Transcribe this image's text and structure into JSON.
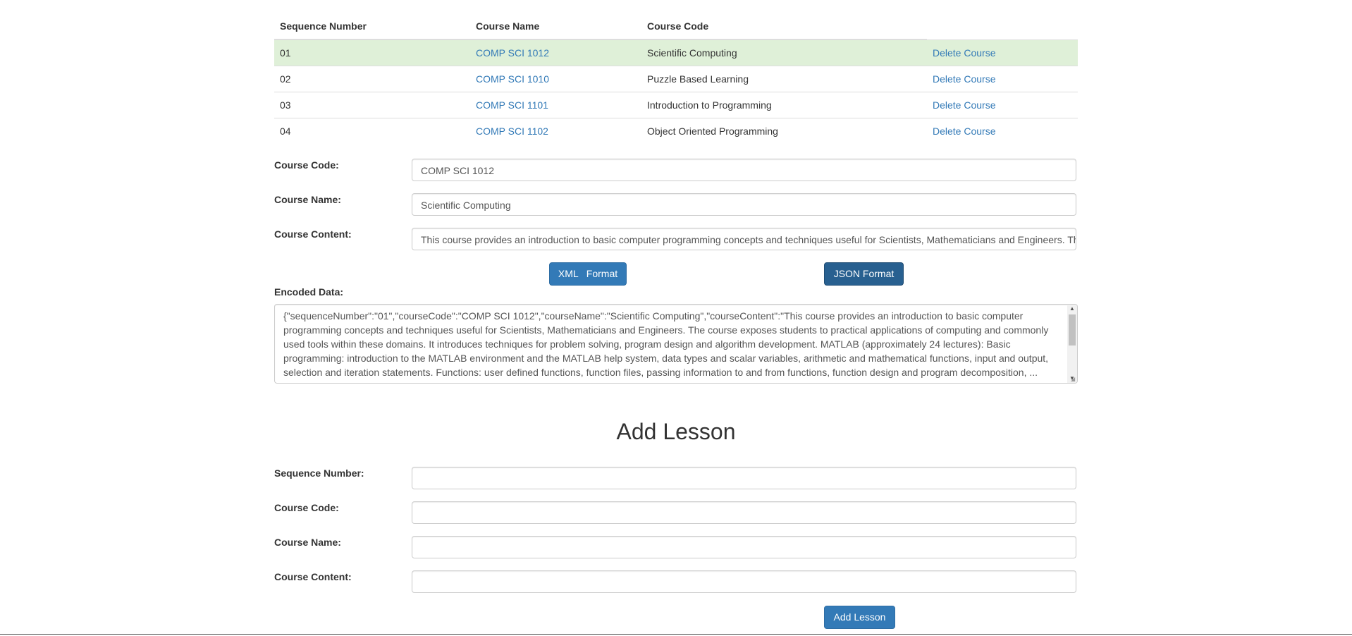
{
  "table": {
    "headers": [
      "Sequence Number",
      "Course Name",
      "Course Code",
      ""
    ],
    "delete_label": "Delete Course",
    "rows": [
      {
        "seq": "01",
        "course_link": "COMP SCI 1012",
        "title": "Scientific Computing"
      },
      {
        "seq": "02",
        "course_link": "COMP SCI 1010",
        "title": "Puzzle Based Learning"
      },
      {
        "seq": "03",
        "course_link": "COMP SCI 1101",
        "title": "Introduction to Programming"
      },
      {
        "seq": "04",
        "course_link": "COMP SCI 1102",
        "title": "Object Oriented Programming"
      }
    ]
  },
  "edit_form": {
    "course_code_label": "Course Code:",
    "course_code_value": "COMP SCI 1012",
    "course_name_label": "Course Name:",
    "course_name_value": "Scientific Computing",
    "course_content_label": "Course Content:",
    "course_content_value": "This course provides an introduction to basic computer programming concepts and techniques useful for Scientists, Mathematicians and Engineers. The",
    "xml_button": "XML   Format",
    "json_button": "JSON Format",
    "encoded_label": "Encoded Data:",
    "encoded_value": "{\"sequenceNumber\":\"01\",\"courseCode\":\"COMP SCI 1012\",\"courseName\":\"Scientific Computing\",\"courseContent\":\"This course provides an introduction to basic computer programming concepts and techniques useful for Scientists, Mathematicians and Engineers. The course exposes students to practical applications of computing and commonly used tools within these domains. It introduces techniques for problem solving, program design and algorithm development. MATLAB (approximately 24 lectures): Basic programming: introduction to the MATLAB environment and the MATLAB help system, data types and scalar variables, arithmetic and mathematical functions, input and output, selection and iteration statements. Functions: user defined functions, function files, passing information to and from functions, function design and program decomposition, ..."
  },
  "add_lesson": {
    "title": "Add Lesson",
    "sequence_label": "Sequence Number:",
    "sequence_value": "",
    "course_code_label": "Course Code:",
    "course_code_value": "",
    "course_name_label": "Course Name:",
    "course_name_value": "",
    "course_content_label": "Course Content:",
    "course_content_value": "",
    "submit_button": "Add Lesson"
  },
  "colors": {
    "link": "#337ab7",
    "primary_button": "#337ab7",
    "active_button": "#286090",
    "selected_row": "#dff0d8"
  }
}
